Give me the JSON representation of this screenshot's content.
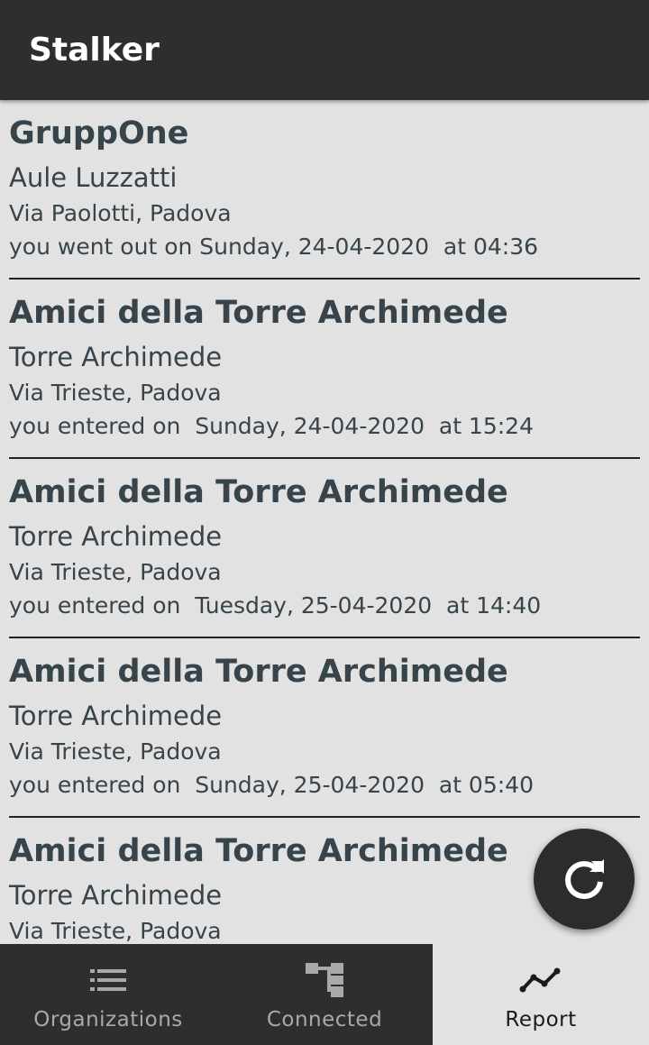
{
  "app_bar": {
    "title": "Stalker"
  },
  "entries": [
    {
      "org_name": "GruppOne",
      "place_name": "Aule Luzzatti",
      "address": "Via Paolotti, Padova",
      "event_line": "you went out on Sunday, 24-04-2020  at 04:36"
    },
    {
      "org_name": "Amici della Torre Archimede",
      "place_name": "Torre Archimede",
      "address": "Via Trieste, Padova",
      "event_line": "you entered on  Sunday, 24-04-2020  at 15:24"
    },
    {
      "org_name": "Amici della Torre Archimede",
      "place_name": "Torre Archimede",
      "address": "Via Trieste, Padova",
      "event_line": "you entered on  Tuesday, 25-04-2020  at 14:40"
    },
    {
      "org_name": "Amici della Torre Archimede",
      "place_name": "Torre Archimede",
      "address": "Via Trieste, Padova",
      "event_line": "you entered on  Sunday, 25-04-2020  at 05:40"
    },
    {
      "org_name": "Amici della Torre Archimede",
      "place_name": "Torre Archimede",
      "address": "Via Trieste, Padova",
      "event_line": ""
    }
  ],
  "fab": {
    "icon": "refresh-icon"
  },
  "bottom_nav": {
    "items": [
      {
        "label": "Organizations",
        "icon": "list-icon",
        "active": false
      },
      {
        "label": "Connected",
        "icon": "hierarchy-icon",
        "active": false
      },
      {
        "label": "Report",
        "icon": "trend-icon",
        "active": true
      }
    ]
  },
  "colors": {
    "app_bar": "#2e2e2e",
    "background": "#e2e2e2",
    "text": "#37444b",
    "nav_inactive": "#a9a9a9",
    "fab": "#2c2c2c"
  }
}
